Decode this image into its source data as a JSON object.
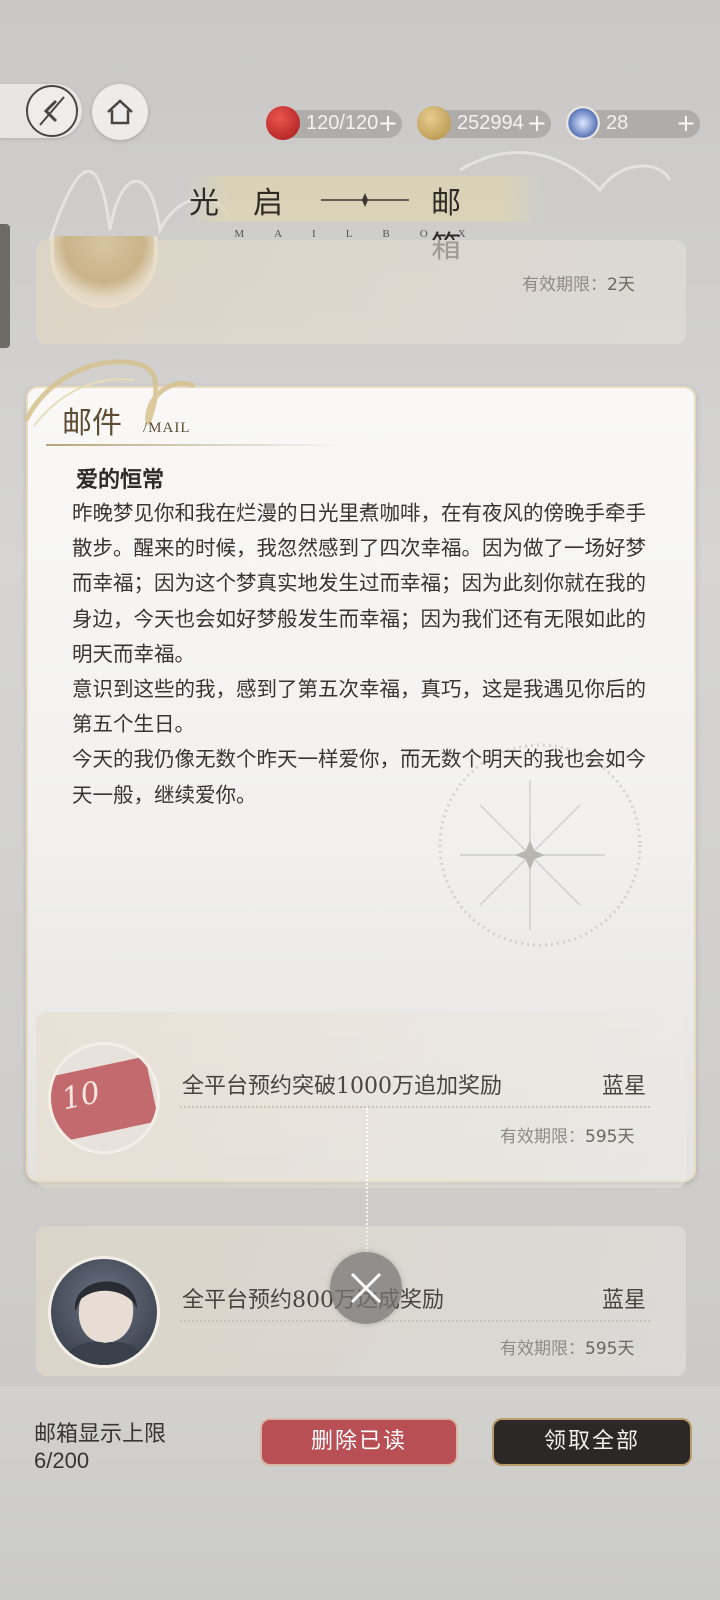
{
  "header": {
    "resources": [
      {
        "icon": "apple-icon",
        "value": "120/120",
        "color": "#c8262a"
      },
      {
        "icon": "coin-icon",
        "value": "252994",
        "color": "#c9a35a"
      },
      {
        "icon": "crystal-icon",
        "value": "28",
        "color": "#5a76b8"
      }
    ],
    "plus": "+"
  },
  "title": {
    "left": "光启",
    "right": "邮箱",
    "subtitle": "MAILBOX"
  },
  "top_card": {
    "expiry_label": "有效期限：",
    "expiry_value": "2天"
  },
  "dialog": {
    "header": "邮件",
    "header_sub": "/MAIL",
    "mail_title": "爱的恒常",
    "paragraphs": [
      "昨晚梦见你和我在烂漫的日光里煮咖啡，在有夜风的傍晚手牵手散步。醒来的时候，我忽然感到了四次幸福。因为做了一场好梦而幸福；因为这个梦真实地发生过而幸福；因为此刻你就在我的身边，今天也会如好梦般发生而幸福；因为我们还有无限如此的明天而幸福。",
      "意识到这些的我，感到了第五次幸福，真巧，这是我遇见你后的第五个生日。",
      "今天的我仍像无数个昨天一样爱你，而无数个明天的我也会如今天一般，继续爱你。"
    ]
  },
  "mail_items": [
    {
      "name": "全平台预约突破1000万追加奖励",
      "sender": "蓝星",
      "expiry_label": "有效期限：",
      "expiry_value": "595天",
      "thumb_text": "10"
    },
    {
      "name": "全平台预约800万达成奖励",
      "sender": "蓝星",
      "expiry_label": "有效期限：",
      "expiry_value": "595天"
    }
  ],
  "footer": {
    "limit_label": "邮箱显示上限",
    "limit_value": "6/200",
    "delete_read": "删除已读",
    "claim_all": "领取全部"
  }
}
